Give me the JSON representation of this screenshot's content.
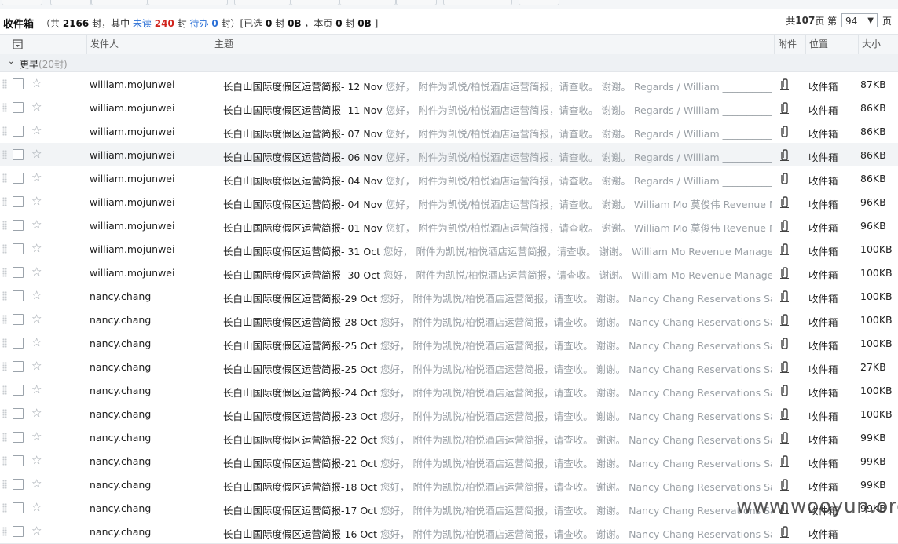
{
  "header": {
    "title": "收件箱",
    "counts_open": "（共",
    "total": "2166",
    "counts_mid1": "封，其中",
    "unread_label": "未读",
    "unread": "240",
    "counts_mid2": "封",
    "todo_label": "待办",
    "todo": "0",
    "counts_mid3": "封）[已选",
    "selected_count": "0",
    "counts_mid4": "封",
    "selected_size": "0B",
    "counts_mid5": "，本页",
    "page_count": "0",
    "counts_mid6": "封",
    "page_size": "0B",
    "counts_close": "]"
  },
  "pager": {
    "total_pages_prefix": "共",
    "total_pages": "107",
    "total_pages_suffix": "页 第",
    "current_page": "94",
    "suffix": "页"
  },
  "columns": {
    "sender": "发件人",
    "subject": "主题",
    "attachment": "附件",
    "location": "位置",
    "size": "大小"
  },
  "group": {
    "label": "更早",
    "count": "(20封)"
  },
  "emails": [
    {
      "sender": "william.mojunwei",
      "subject": "长白山国际度假区运营简报- 12 Nov",
      "preview": "您好， 附件为凯悦/柏悦酒店运营简报，请查收。 谢谢。 Regards / William _______________",
      "location": "收件箱",
      "size": "87KB",
      "highlight": false
    },
    {
      "sender": "william.mojunwei",
      "subject": "长白山国际度假区运营简报- 11 Nov",
      "preview": "您好， 附件为凯悦/柏悦酒店运营简报，请查收。 谢谢。 Regards / William _______________",
      "location": "收件箱",
      "size": "86KB",
      "highlight": false
    },
    {
      "sender": "william.mojunwei",
      "subject": "长白山国际度假区运营简报- 07 Nov",
      "preview": "您好， 附件为凯悦/柏悦酒店运营简报，请查收。 谢谢。 Regards / William _______________",
      "location": "收件箱",
      "size": "86KB",
      "highlight": false
    },
    {
      "sender": "william.mojunwei",
      "subject": "长白山国际度假区运营简报- 06 Nov",
      "preview": "您好， 附件为凯悦/柏悦酒店运营简报，请查收。 谢谢。 Regards / William _______________",
      "location": "收件箱",
      "size": "86KB",
      "highlight": true
    },
    {
      "sender": "william.mojunwei",
      "subject": "长白山国际度假区运营简报- 04 Nov",
      "preview": "您好， 附件为凯悦/柏悦酒店运营简报，请查收。 谢谢。 Regards / William _______________",
      "location": "收件箱",
      "size": "86KB",
      "highlight": false
    },
    {
      "sender": "william.mojunwei",
      "subject": "长白山国际度假区运营简报- 04 Nov",
      "preview": "您好， 附件为凯悦/柏悦酒店运营简报，请查收。 谢谢。 William Mo 莫俊伟 Revenue Manag",
      "location": "收件箱",
      "size": "96KB",
      "highlight": false
    },
    {
      "sender": "william.mojunwei",
      "subject": "长白山国际度假区运营简报- 01 Nov",
      "preview": "您好， 附件为凯悦/柏悦酒店运营简报，请查收。 谢谢。 William Mo 莫俊伟 Revenue Manag",
      "location": "收件箱",
      "size": "96KB",
      "highlight": false
    },
    {
      "sender": "william.mojunwei",
      "subject": "长白山国际度假区运营简报- 31 Oct",
      "preview": "您好， 附件为凯悦/柏悦酒店运营简报，请查收。 谢谢。 William Mo Revenue Manager Park",
      "location": "收件箱",
      "size": "100KB",
      "highlight": false
    },
    {
      "sender": "william.mojunwei",
      "subject": "长白山国际度假区运营简报- 30 Oct",
      "preview": "您好， 附件为凯悦/柏悦酒店运营简报，请查收。 谢谢。 William Mo Revenue Manager Park",
      "location": "收件箱",
      "size": "100KB",
      "highlight": false
    },
    {
      "sender": "nancy.chang",
      "subject": "长白山国际度假区运营简报-29 Oct",
      "preview": "您好， 附件为凯悦/柏悦酒店运营简报，请查收。 谢谢。 Nancy Chang Reservations Sales Ag",
      "location": "收件箱",
      "size": "100KB",
      "highlight": false
    },
    {
      "sender": "nancy.chang",
      "subject": "长白山国际度假区运营简报-28 Oct",
      "preview": "您好， 附件为凯悦/柏悦酒店运营简报，请查收。 谢谢。 Nancy Chang Reservations Sales Ag",
      "location": "收件箱",
      "size": "100KB",
      "highlight": false
    },
    {
      "sender": "nancy.chang",
      "subject": "长白山国际度假区运营简报-25 Oct",
      "preview": "您好， 附件为凯悦/柏悦酒店运营简报，请查收。 谢谢。 Nancy Chang Reservations Sales Ag",
      "location": "收件箱",
      "size": "100KB",
      "highlight": false
    },
    {
      "sender": "nancy.chang",
      "subject": "长白山国际度假区运营简报-25 Oct",
      "preview": "您好， 附件为凯悦/柏悦酒店运营简报，请查收。 谢谢。 Nancy Chang Reservations Sales Ag",
      "location": "收件箱",
      "size": "27KB",
      "highlight": false
    },
    {
      "sender": "nancy.chang",
      "subject": "长白山国际度假区运营简报-24 Oct",
      "preview": "您好， 附件为凯悦/柏悦酒店运营简报，请查收。 谢谢。 Nancy Chang Reservations Sales Ag",
      "location": "收件箱",
      "size": "100KB",
      "highlight": false
    },
    {
      "sender": "nancy.chang",
      "subject": "长白山国际度假区运营简报-23 Oct",
      "preview": "您好， 附件为凯悦/柏悦酒店运营简报，请查收。 谢谢。 Nancy Chang Reservations Sales Ag",
      "location": "收件箱",
      "size": "100KB",
      "highlight": false
    },
    {
      "sender": "nancy.chang",
      "subject": "长白山国际度假区运营简报-22 Oct",
      "preview": "您好， 附件为凯悦/柏悦酒店运营简报，请查收。 谢谢。 Nancy Chang Reservations Sales Ag",
      "location": "收件箱",
      "size": "99KB",
      "highlight": false
    },
    {
      "sender": "nancy.chang",
      "subject": "长白山国际度假区运营简报-21 Oct",
      "preview": "您好， 附件为凯悦/柏悦酒店运营简报，请查收。 谢谢。 Nancy Chang Reservations Sales Ag",
      "location": "收件箱",
      "size": "99KB",
      "highlight": false
    },
    {
      "sender": "nancy.chang",
      "subject": "长白山国际度假区运营简报-18 Oct",
      "preview": "您好， 附件为凯悦/柏悦酒店运营简报，请查收。 谢谢。 Nancy Chang Reservations Sales Ag",
      "location": "收件箱",
      "size": "99KB",
      "highlight": false
    },
    {
      "sender": "nancy.chang",
      "subject": "长白山国际度假区运营简报-17 Oct",
      "preview": "您好， 附件为凯悦/柏悦酒店运营简报，请查收。 谢谢。 Nancy Chang Reservations Sales Ag",
      "location": "收件箱",
      "size": "99KB",
      "highlight": false
    },
    {
      "sender": "nancy.chang",
      "subject": "长白山国际度假区运营简报-16 Oct",
      "preview": "您好， 附件为凯悦/柏悦酒店运营简报，请查收。 谢谢。 Nancy Chang Reservations Sales Ag",
      "location": "收件箱",
      "size": "",
      "highlight": false
    }
  ],
  "icons": {
    "star": "star-outline-icon",
    "attachment": "paperclip-icon",
    "column_menu": "column-settings-icon",
    "collapse": "chevron-down-icon"
  },
  "watermark": "www.wooyun.org"
}
